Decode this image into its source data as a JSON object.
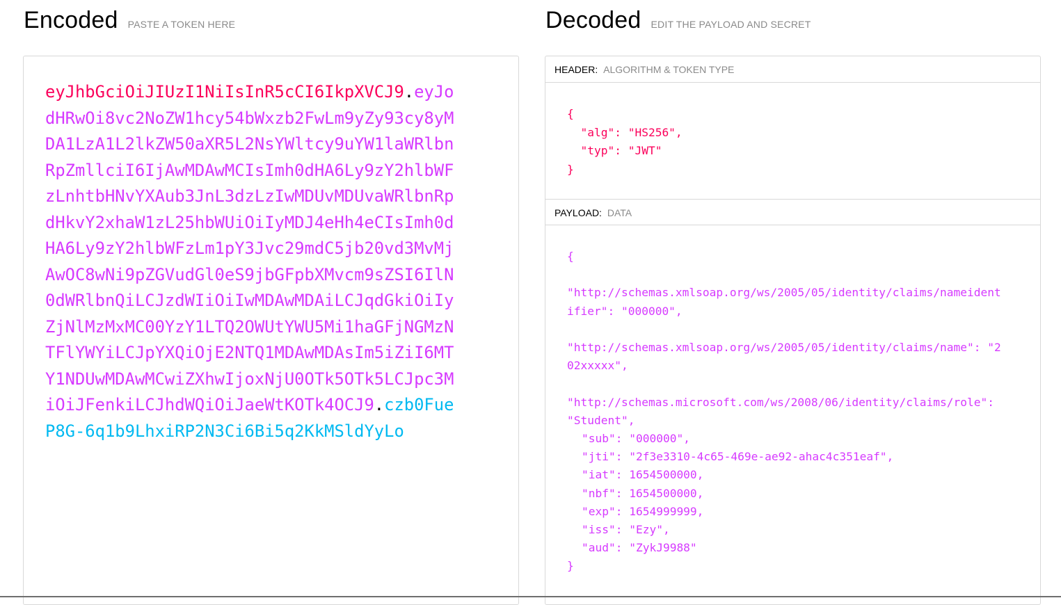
{
  "encoded": {
    "title": "Encoded",
    "subtitle": "PASTE A TOKEN HERE",
    "token": {
      "header": "eyJhbGciOiJIUzI1NiIsInR5cCI6IkpXVCJ9",
      "payload": "eyJodHRwOi8vc2NoZW1hcy54bWxzb2FwLm9yZy93cy8yMDA1LzA1L2lkZW50aXR5L2NsYWltcy9uYW1laWRlbnRpZmllciI6IjAwMDAwMCIsImh0dHA6Ly9zY2hlbWFzLnhtbHNvYXAub3JnL3dzLzIwMDUvMDUvaWRlbnRpdHkvY2xhaW1zL25hbWUiOiIyMDJ4eHh4eCIsImh0dHA6Ly9zY2hlbWFzLm1pY3Jvc29mdC5jb20vd3MvMjAwOC8wNi9pZGVudGl0eS9jbGFpbXMvcm9sZSI6IlN0dWRlbnQiLCJzdWIiOiIwMDAwMDAiLCJqdGkiOiIyZjNlMzMxMC00YzY1LTQ2OWUtYWU5Mi1haGFjNGMzNTFlYWYiLCJpYXQiOjE2NTQ1MDAwMDAsIm5iZiI6MTY1NDUwMDAwMCwiZXhwIjoxNjU0OTk5OTk5LCJpc3MiOiJFenkiLCJhdWQiOiJaeWtKOTk4OCJ9",
      "signature": "czb0FueP8G-6q1b9LhxiRP2N3Ci6Bi5q2KkMSldYyLo",
      "dot": "."
    }
  },
  "decoded": {
    "title": "Decoded",
    "subtitle": "EDIT THE PAYLOAD AND SECRET",
    "header_section": {
      "label": "HEADER:",
      "sublabel": "ALGORITHM & TOKEN TYPE",
      "json_text": "{\n  \"alg\": \"HS256\",\n  \"typ\": \"JWT\"\n}"
    },
    "payload_section": {
      "label": "PAYLOAD:",
      "sublabel": "DATA",
      "lines": {
        "open": "{",
        "nameid": "\"http://schemas.xmlsoap.org/ws/2005/05/identity/claims/nameidentifier\": \"000000\",",
        "name": "\"http://schemas.xmlsoap.org/ws/2005/05/identity/claims/name\": \"202xxxxx\",",
        "role": "\"http://schemas.microsoft.com/ws/2008/06/identity/claims/role\": \"Student\",",
        "sub": "\"sub\": \"000000\",",
        "jti": "\"jti\": \"2f3e3310-4c65-469e-ae92-ahac4c351eaf\",",
        "iat": "\"iat\": 1654500000,",
        "nbf": "\"nbf\": 1654500000,",
        "exp": "\"exp\": 1654999999,",
        "iss": "\"iss\": \"Ezy\",",
        "aud": "\"aud\": \"ZykJ9988\"",
        "close": "}"
      }
    }
  },
  "colors": {
    "header": "#fb015b",
    "payload": "#d63aff",
    "signature": "#00b9f1"
  }
}
